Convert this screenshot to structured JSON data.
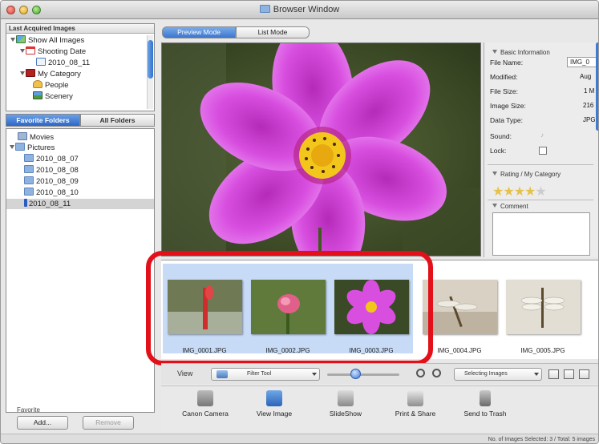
{
  "window": {
    "title": "Browser Window"
  },
  "last_acquired": {
    "header": "Last Acquired Images",
    "items": [
      {
        "label": "Show All Images",
        "icon": "all-images-icon"
      },
      {
        "label": "Shooting Date",
        "icon": "calendar-icon"
      },
      {
        "label": "2010_08_11",
        "icon": "date-icon"
      },
      {
        "label": "My Category",
        "icon": "category-icon"
      },
      {
        "label": "People",
        "icon": "people-icon"
      },
      {
        "label": "Scenery",
        "icon": "scenery-icon"
      }
    ]
  },
  "folder_tabs": {
    "favorite": "Favorite Folders",
    "all": "All Folders"
  },
  "folders": {
    "items": [
      {
        "label": "Movies"
      },
      {
        "label": "Pictures"
      },
      {
        "label": "2010_08_07"
      },
      {
        "label": "2010_08_08"
      },
      {
        "label": "2010_08_09"
      },
      {
        "label": "2010_08_10"
      },
      {
        "label": "2010_08_11"
      }
    ],
    "selected": "2010_08_11"
  },
  "favorite": {
    "label": "Favorite",
    "add": "Add...",
    "remove": "Remove"
  },
  "mode_tabs": {
    "preview": "Preview Mode",
    "list": "List Mode"
  },
  "info": {
    "basic_header": "Basic Information",
    "file_name_label": "File Name:",
    "file_name_value": "IMG_0",
    "modified_label": "Modified:",
    "modified_value": "Aug",
    "file_size_label": "File Size:",
    "file_size_value": "1 M",
    "image_size_label": "Image Size:",
    "image_size_value": "216",
    "data_type_label": "Data Type:",
    "data_type_value": "JPG",
    "sound_label": "Sound:",
    "lock_label": "Lock:",
    "rating_header": "Rating / My Category",
    "rating": 4,
    "rating_max": 5,
    "comment_header": "Comment"
  },
  "thumbnails": [
    {
      "label": "IMG_0001.JPG",
      "selected": true
    },
    {
      "label": "IMG_0002.JPG",
      "selected": true
    },
    {
      "label": "IMG_0003.JPG",
      "selected": true
    },
    {
      "label": "IMG_0004.JPG",
      "selected": false
    },
    {
      "label": "IMG_0005.JPG",
      "selected": false
    }
  ],
  "view_toolbar": {
    "view_label": "View",
    "filter_tool": "Filter Tool",
    "selecting_images": "Selecting Images"
  },
  "actions": [
    {
      "label": "Canon Camera",
      "icon": "camera-icon"
    },
    {
      "label": "View Image",
      "icon": "view-image-icon"
    },
    {
      "label": "SlideShow",
      "icon": "slideshow-icon"
    },
    {
      "label": "Print & Share",
      "icon": "printer-icon"
    },
    {
      "label": "Send to Trash",
      "icon": "trash-icon"
    }
  ],
  "status": {
    "text": "No. of Images Selected: 3 / Total: 5 images"
  },
  "colors": {
    "accent": "#2c67c6",
    "highlight": "#e3101a",
    "flower": "#d43fd8"
  }
}
